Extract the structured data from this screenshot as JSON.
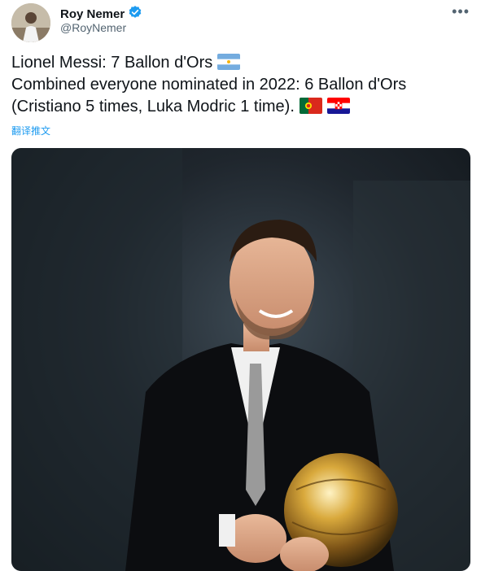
{
  "author": {
    "display_name": "Roy Nemer",
    "handle": "@RoyNemer",
    "verified": true
  },
  "tweet": {
    "line1": "Lionel Messi: 7 Ballon d'Ors",
    "line2": "Combined everyone nominated in 2022: 6 Ballon d'Ors",
    "line3": "(Cristiano 5 times, Luka Modric 1 time).",
    "flags": [
      "argentina-flag",
      "portugal-flag",
      "croatia-flag"
    ]
  },
  "translate_label": "翻译推文",
  "icons": {
    "more": "more-options-icon",
    "verified": "verified-badge-icon"
  },
  "colors": {
    "link": "#1d9bf0",
    "secondary_text": "#536471",
    "verified": "#1d9bf0"
  }
}
